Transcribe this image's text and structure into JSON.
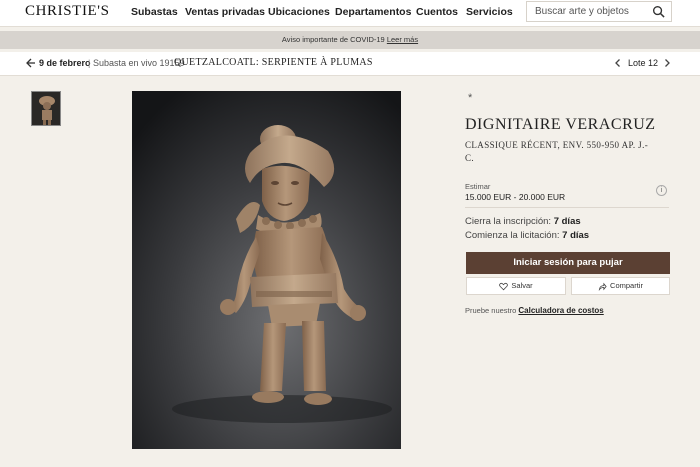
{
  "nav": {
    "logo": "CHRISTIE'S",
    "items": [
      {
        "label": "Subastas"
      },
      {
        "label": "Ventas privadas"
      },
      {
        "label": "Ubicaciones"
      },
      {
        "label": "Departamentos"
      },
      {
        "label": "Cuentos"
      },
      {
        "label": "Servicios"
      }
    ],
    "search_placeholder": "Buscar arte y objetos",
    "search_icon": "search-icon"
  },
  "notice": {
    "text": "Aviso importante de COVID-19",
    "link": "Leer más"
  },
  "breadcrumb": {
    "date": "9 de febrero",
    "separator": "|",
    "live_sale": "Subasta en vivo 19159",
    "sale_title": "QUETZALCOATL: SERPIENTE À PLUMAS",
    "lot": "Lote 12"
  },
  "lot": {
    "marker": "*",
    "title": "DIGNITAIRE VERACRUZ",
    "subtitle": "CLASSIQUE RÉCENT, ENV. 550-950 AP. J.-C.",
    "estimate_label": "Estimar",
    "estimate_value": "15.000 EUR - 20.000 EUR",
    "info_icon": "i",
    "closes_label": "Cierra la inscripción:",
    "closes_value": "7 días",
    "opens_label": "Comienza la licitación:",
    "opens_value": "7 días",
    "bid_button": "Iniciar sesión para pujar",
    "save_button": "Salvar",
    "share_button": "Compartir",
    "calc_prefix": "Pruebe nuestro",
    "calc_link": "Calculadora de costos"
  },
  "colors": {
    "accent_brown": "#5b4033",
    "page_bg": "#f3f0ea",
    "notice_bg": "#d7d3ce"
  }
}
